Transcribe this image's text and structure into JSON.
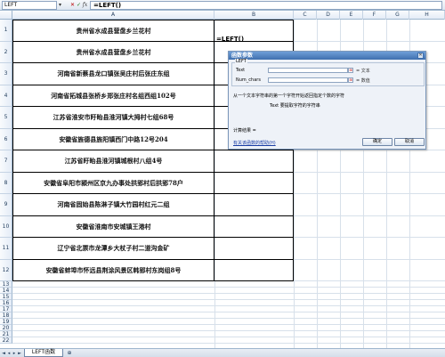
{
  "formula_bar": {
    "name_box": "LEFT",
    "cancel_glyph": "✕",
    "enter_glyph": "✓",
    "fx_label": "fx",
    "formula": "=LEFT()"
  },
  "columns": [
    "A",
    "B",
    "C",
    "D",
    "E",
    "F",
    "G",
    "H"
  ],
  "rows": [
    "1",
    "2",
    "3",
    "4",
    "5",
    "6",
    "7",
    "8",
    "9",
    "10",
    "11",
    "12",
    "13",
    "14",
    "15",
    "16",
    "17",
    "18",
    "19",
    "20",
    "21",
    "22",
    "23",
    "24",
    "25",
    "26",
    "27",
    "28"
  ],
  "cells": {
    "b1": "=LEFT()",
    "col_a": [
      "贵州省水成县营盘乡兰花村",
      "贵州省水成县营盘乡兰花村",
      "河南省新蔡县龙口镇张吴庄村后张庄东组",
      "河南省拓城县张桥乡郑张庄村名组西组102号",
      "江苏省淮安市盱眙县淮河镇大拇村七组68号",
      "安徽省旌德县旌阳镇西门中路12号204",
      "江苏省盱眙县淮河镇城根村八组4号",
      "安徽省阜阳市颍州区京九办事处拱郢村后拱郢78户",
      "河南省固始县陈淋子镇大竹园村红元二组",
      "安徽省淮南市安城镇王港村",
      "辽宁省北票市龙潭乡大杖子村二道沟金矿",
      "安徽省蚌埠市怀远县荆涂风景区韩郢村东岗组8号"
    ]
  },
  "dialog": {
    "title": "函数参数",
    "close_glyph": "✕",
    "function_name": "LEFT",
    "args": [
      {
        "label": "Text",
        "value": "= 文本"
      },
      {
        "label": "Num_chars",
        "value": "= 数值"
      }
    ],
    "description": "从一个文本字符串的第一个字符开始返回指定个数的字符",
    "arg_description": "Text  要提取字符的字符串",
    "result_label": "计算结果 =",
    "help_link": "有关该函数的帮助(H)",
    "ok_label": "确定",
    "cancel_label": "取消"
  },
  "sheet_tabs": {
    "nav_first": "◄",
    "nav_prev": "◂",
    "nav_next": "▸",
    "nav_last": "►",
    "active": "LEFT函数",
    "new_sheet_glyph": "⊕"
  }
}
